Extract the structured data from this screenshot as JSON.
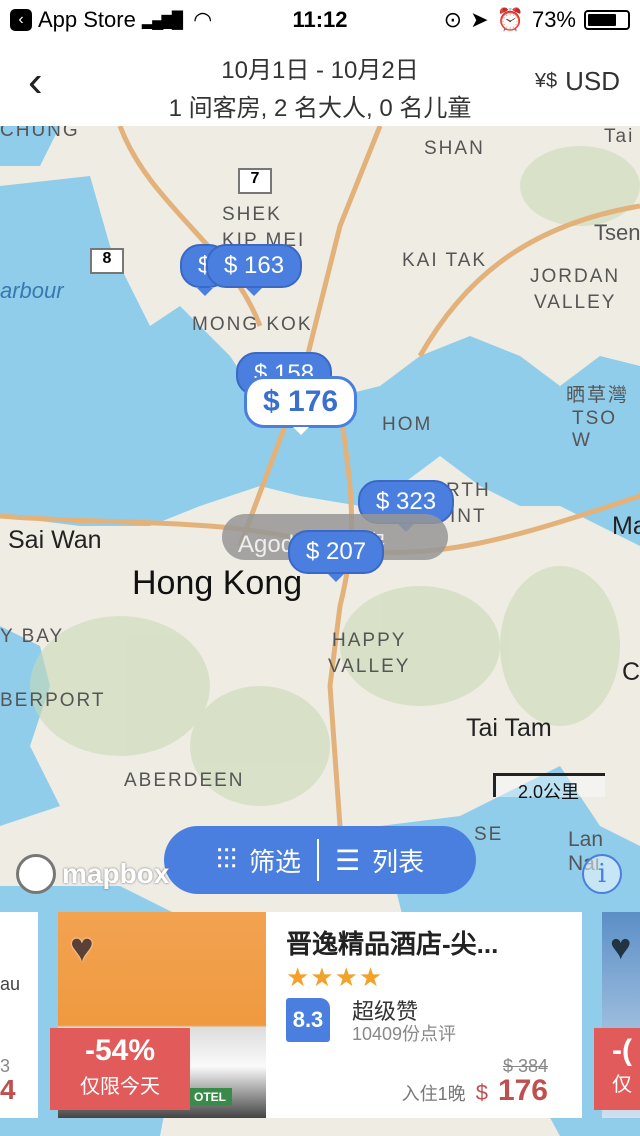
{
  "status_bar": {
    "back_app": "App Store",
    "time": "11:12",
    "battery": "73%",
    "battery_level": 0.73
  },
  "header": {
    "dates": "10月1日 - 10月2日",
    "guests": "1 间客房, 2 名大人, 0 名儿童",
    "currency": "USD",
    "currency_icon": "currency-exchange-icon",
    "back_icon": "chevron-left-icon"
  },
  "map": {
    "labels": [
      "CHUNG",
      "SHAN",
      "SHEK",
      "KIP MEI",
      "KAI TAK",
      "Tsen",
      "JORDAN",
      "VALLEY",
      "arbour",
      "MONG KOK",
      "HOM",
      "晒草灣",
      "TSO W",
      "RTH",
      "INT",
      "Sai Wan",
      "Hong Kong",
      "Ma",
      "Y BAY",
      "HAPPY",
      "VALLEY",
      "C",
      "BERPORT",
      "Tai Tam",
      "ABERDEEN",
      "Lan Nai",
      "SE",
      "Tai"
    ],
    "road_numbers": [
      "7",
      "8"
    ],
    "markers": [
      "$",
      "$ 163",
      "$ 158",
      "$ 176",
      "$ 323",
      "$ 207"
    ],
    "agoda_label": "Agoda 有空房",
    "scale": "2.0公里",
    "attribution": "mapbox",
    "info_icon": "i",
    "water_color": "#8fcdeb",
    "land_color": "#efece4",
    "accent": "#4a7fe0"
  },
  "toolbar": {
    "filter": "筛选",
    "list": "列表"
  },
  "hotel": {
    "name": "晋逸精品酒店-尖...",
    "stars": 4,
    "stars_text": "★★★★",
    "score": "8.3",
    "rating_label": "超级赞",
    "reviews": "10409份点评",
    "original_price": "$ 384",
    "per_night": "入住1晚",
    "currency": "$",
    "price": "176",
    "discount": "-54%",
    "discount_label": "仅限今天",
    "photo_sign": "OTEL"
  },
  "side_cards": {
    "left_fragments": [
      "au",
      "3",
      "4"
    ],
    "right_fragments": [
      "-(",
      "仅"
    ]
  }
}
